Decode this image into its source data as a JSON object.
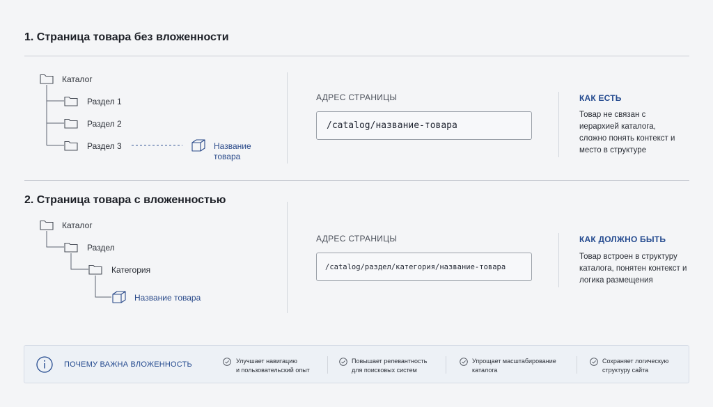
{
  "section1": {
    "title": "1. Страница товара без вложенности",
    "tree": {
      "root": "Каталог",
      "items": [
        "Раздел 1",
        "Раздел 2",
        "Раздел 3"
      ],
      "product": "Название товара"
    },
    "address_label": "АДРЕС СТРАНИЦЫ",
    "url": "/catalog/название-товара",
    "status_title": "КАК ЕСТЬ",
    "status_text": "Товар не связан с иерархией каталога, сложно понять контекст и место в структуре"
  },
  "section2": {
    "title": "2. Страница товара с вложенностью",
    "tree": {
      "root": "Каталог",
      "level1": "Раздел",
      "level2": "Категория",
      "product": "Название товара"
    },
    "address_label": "АДРЕС СТРАНИЦЫ",
    "url": "/catalog/раздел/категория/название-товара",
    "status_title": "КАК ДОЛЖНО БЫТЬ",
    "status_text": "Товар встроен в структуру каталога, понятен контекст и логика размещения"
  },
  "info": {
    "title": "ПОЧЕМУ ВАЖНА ВЛОЖЕННОСТЬ",
    "icon": "info-icon",
    "benefits": [
      {
        "line1": "Улучшает навигацию",
        "line2": "и пользовательский опыт"
      },
      {
        "line1": "Повышает релевантность",
        "line2": "для поисковых систем"
      },
      {
        "line1": "Упрощает масштабирование",
        "line2": "каталога"
      },
      {
        "line1": "Сохраняет логическую",
        "line2": "структуру сайта"
      }
    ]
  },
  "colors": {
    "accent": "#244a8f",
    "background": "#f4f5f7",
    "rule": "#c9cdd4"
  }
}
